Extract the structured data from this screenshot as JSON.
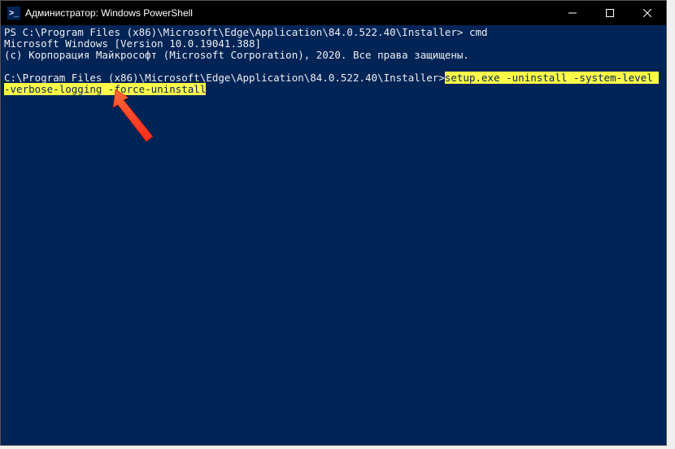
{
  "titlebar": {
    "icon_glyph": ">_",
    "title": "Администратор: Windows PowerShell"
  },
  "terminal": {
    "line1_prompt": "PS C:\\Program Files (x86)\\Microsoft\\Edge\\Application\\84.0.522.40\\Installer> ",
    "line1_cmd": "cmd",
    "line2": "Microsoft Windows [Version 10.0.19041.388]",
    "line3": "(c) Корпорация Майкрософт (Microsoft Corporation), 2020. Все права защищены.",
    "line4_prompt": "C:\\Program Files (x86)\\Microsoft\\Edge\\Application\\84.0.522.40\\Installer>",
    "line4_cmd": "setup.exe -uninstall -system-level -verbose-logging -force-uninstall"
  }
}
